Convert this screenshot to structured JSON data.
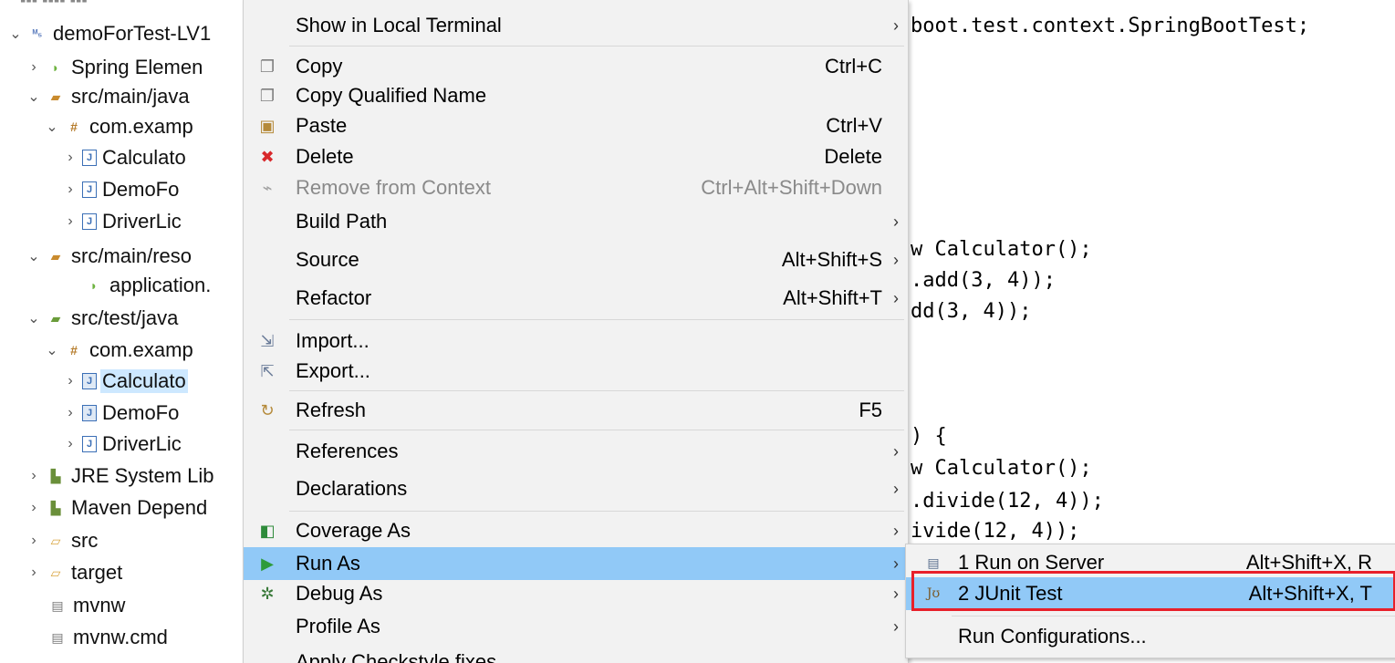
{
  "tree": {
    "items": [
      {
        "label": "demoForTest-LV1",
        "chev": "⌄",
        "icon": "project-icon"
      },
      {
        "label": "Spring Elemen",
        "chev": "›",
        "icon": "spring-leaf-icon"
      },
      {
        "label": "src/main/java",
        "chev": "⌄",
        "icon": "source-folder-icon"
      },
      {
        "label": "com.examp",
        "chev": "⌄",
        "icon": "package-icon"
      },
      {
        "label": "Calculato",
        "chev": "›",
        "icon": "java-file-icon"
      },
      {
        "label": "DemoFo",
        "chev": "›",
        "icon": "java-file-icon"
      },
      {
        "label": "DriverLic",
        "chev": "›",
        "icon": "java-file-icon"
      },
      {
        "label": "src/main/reso",
        "chev": "⌄",
        "icon": "source-folder-icon"
      },
      {
        "label": "application.",
        "chev": "",
        "icon": "spring-leaf-icon"
      },
      {
        "label": "src/test/java",
        "chev": "⌄",
        "icon": "source-folder-icon"
      },
      {
        "label": "com.examp",
        "chev": "⌄",
        "icon": "package-icon"
      },
      {
        "label": "Calculato",
        "chev": "›",
        "icon": "java-test-file-icon"
      },
      {
        "label": "DemoFo",
        "chev": "›",
        "icon": "java-test-file-icon"
      },
      {
        "label": "DriverLic",
        "chev": "›",
        "icon": "java-file-icon"
      },
      {
        "label": "JRE System Lib",
        "chev": "›",
        "icon": "library-icon"
      },
      {
        "label": "Maven Depend",
        "chev": "›",
        "icon": "library-icon"
      },
      {
        "label": "src",
        "chev": "›",
        "icon": "folder-icon"
      },
      {
        "label": "target",
        "chev": "›",
        "icon": "folder-icon"
      },
      {
        "label": "mvnw",
        "chev": "",
        "icon": "file-icon"
      },
      {
        "label": "mvnw.cmd",
        "chev": "",
        "icon": "file-icon"
      }
    ]
  },
  "editor": {
    "lines": [
      {
        "text": "boot.test.context.SpringBootTest;"
      },
      {
        "text": "w Calculator();"
      },
      {
        "text": ".add(3, 4));"
      },
      {
        "text": "dd(3, 4));"
      },
      {
        "text": ") {"
      },
      {
        "text": "w Calculator();"
      },
      {
        "text": ".divide(12, 4));"
      },
      {
        "text": "ivide(12, 4));"
      }
    ]
  },
  "menu": {
    "items": [
      {
        "label": "Show in Local Terminal",
        "shortcut": "",
        "arrow": "›",
        "icon": ""
      },
      {
        "label": "Copy",
        "shortcut": "Ctrl+C",
        "arrow": "",
        "icon": "copy-icon"
      },
      {
        "label": "Copy Qualified Name",
        "shortcut": "",
        "arrow": "",
        "icon": "copy-qualified-icon"
      },
      {
        "label": "Paste",
        "shortcut": "Ctrl+V",
        "arrow": "",
        "icon": "paste-icon"
      },
      {
        "label": "Delete",
        "shortcut": "Delete",
        "arrow": "",
        "icon": "delete-icon"
      },
      {
        "label": "Remove from Context",
        "shortcut": "Ctrl+Alt+Shift+Down",
        "arrow": "",
        "icon": "remove-context-icon"
      },
      {
        "label": "Build Path",
        "shortcut": "",
        "arrow": "›",
        "icon": ""
      },
      {
        "label": "Source",
        "shortcut": "Alt+Shift+S",
        "arrow": "›",
        "icon": ""
      },
      {
        "label": "Refactor",
        "shortcut": "Alt+Shift+T",
        "arrow": "›",
        "icon": ""
      },
      {
        "label": "Import...",
        "shortcut": "",
        "arrow": "",
        "icon": "import-icon"
      },
      {
        "label": "Export...",
        "shortcut": "",
        "arrow": "",
        "icon": "export-icon"
      },
      {
        "label": "Refresh",
        "shortcut": "F5",
        "arrow": "",
        "icon": "refresh-icon"
      },
      {
        "label": "References",
        "shortcut": "",
        "arrow": "›",
        "icon": ""
      },
      {
        "label": "Declarations",
        "shortcut": "",
        "arrow": "›",
        "icon": ""
      },
      {
        "label": "Coverage As",
        "shortcut": "",
        "arrow": "›",
        "icon": "coverage-icon"
      },
      {
        "label": "Run As",
        "shortcut": "",
        "arrow": "›",
        "icon": "run-icon"
      },
      {
        "label": "Debug As",
        "shortcut": "",
        "arrow": "›",
        "icon": "debug-icon"
      },
      {
        "label": "Profile As",
        "shortcut": "",
        "arrow": "›",
        "icon": ""
      },
      {
        "label": "Apply Checkstyle fixes",
        "shortcut": "",
        "arrow": "",
        "icon": ""
      }
    ]
  },
  "submenu": {
    "items": [
      {
        "label": "1 Run on Server",
        "shortcut": "Alt+Shift+X, R",
        "icon": "server-icon"
      },
      {
        "label": "2 JUnit Test",
        "shortcut": "Alt+Shift+X, T",
        "icon": "junit-icon",
        "icon_text": "Jʊ"
      },
      {
        "label": "Run Configurations...",
        "shortcut": "",
        "icon": ""
      }
    ]
  },
  "colors": {
    "highlight": "#91c9f7",
    "selection_box": "#e8202a",
    "menu_bg": "#f2f2f2"
  }
}
